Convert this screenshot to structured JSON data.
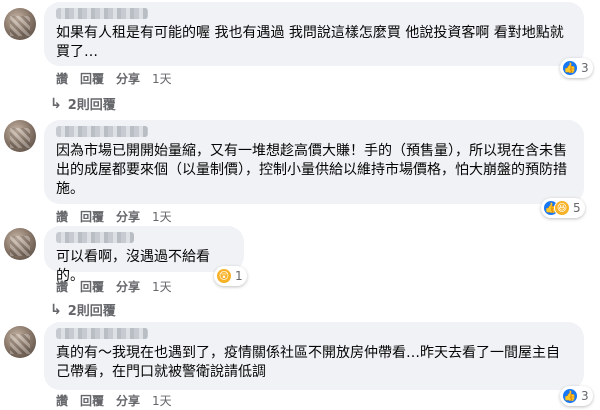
{
  "comments": [
    {
      "text": "如果有人租是有可能的喔 我也有遇過 我問說這樣怎麼買 他說投資客啊 看對地點就買了…",
      "reactions": {
        "icons": [
          "like-icon"
        ],
        "count": "3"
      },
      "actions": {
        "like": "讚",
        "reply": "回覆",
        "share": "分享",
        "time": "1天"
      },
      "replies": "2則回覆"
    },
    {
      "text": "因為市場已開開始量縮，又有一堆想趁高價大賺！手的（預售量），所以現在含未售出的成屋都要來個（以量制價），控制小量供給以維持市場價格，怕大崩盤的預防措施。",
      "reactions": {
        "icons": [
          "like-icon",
          "haha-icon"
        ],
        "count": "5"
      },
      "actions": {
        "like": "讚",
        "reply": "回覆",
        "share": "分享",
        "time": "1天"
      }
    },
    {
      "text": "可以看啊，沒遇過不給看的。",
      "reactions": {
        "icons": [
          "wow-icon"
        ],
        "count": "1"
      },
      "actions": {
        "like": "讚",
        "reply": "回覆",
        "share": "分享",
        "time": "1天"
      },
      "replies": "2則回覆"
    },
    {
      "text": "真的有～我現在也遇到了，疫情關係社區不開放房仲帶看…昨天去看了一間屋主自己帶看，在門口就被警衛說請低調",
      "reactions": {
        "icons": [
          "like-icon"
        ],
        "count": "3"
      },
      "actions": {
        "like": "讚",
        "reply": "回覆",
        "share": "分享",
        "time": "1天"
      }
    }
  ],
  "colors": {
    "bubble": "#f0f2f5",
    "meta_text": "#65676b",
    "like_blue": "#1877f2",
    "haha_yellow": "#f7b125"
  }
}
